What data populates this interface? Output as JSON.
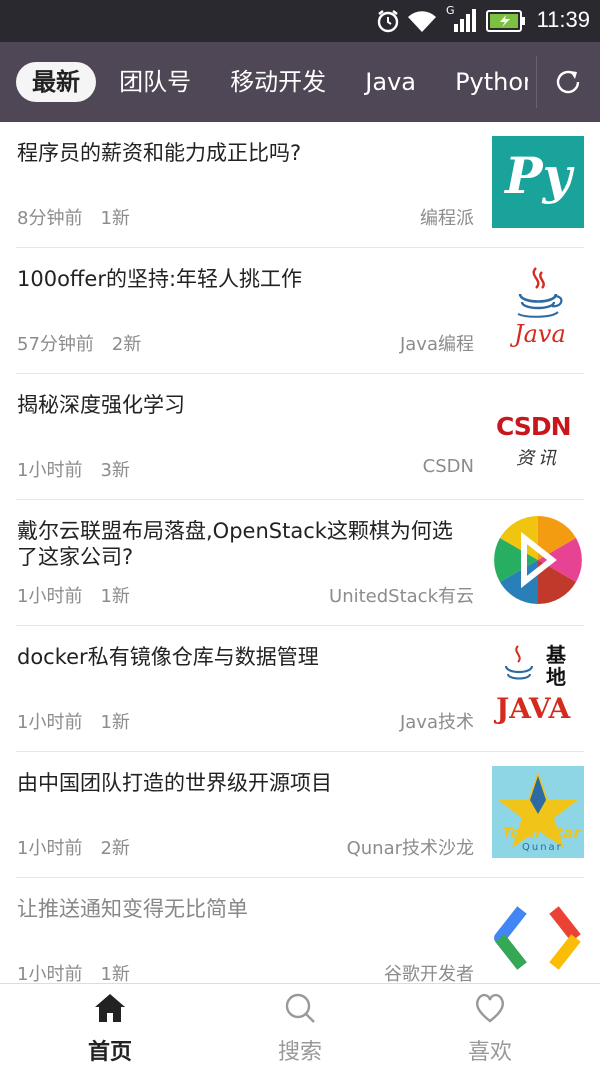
{
  "status": {
    "time": "11:39",
    "network": "G"
  },
  "tabs": [
    {
      "label": "最新",
      "active": true
    },
    {
      "label": "团队号"
    },
    {
      "label": "移动开发"
    },
    {
      "label": "Java"
    },
    {
      "label": "Python"
    }
  ],
  "articles": [
    {
      "title": "程序员的薪资和能力成正比吗?",
      "time": "8分钟前",
      "new_count": "1新",
      "source": "编程派",
      "thumb_icon": "py-logo-icon",
      "thumb_text": "Py"
    },
    {
      "title": "100offer的坚持:年轻人挑工作",
      "time": "57分钟前",
      "new_count": "2新",
      "source": "Java编程",
      "thumb_icon": "java-logo-icon",
      "thumb_text": "Java"
    },
    {
      "title": "揭秘深度强化学习",
      "time": "1小时前",
      "new_count": "3新",
      "source": "CSDN",
      "thumb_icon": "csdn-logo-icon",
      "thumb_text": "CSDN",
      "thumb_sub": "资讯"
    },
    {
      "title": "戴尔云联盟布局落盘,OpenStack这颗棋为何选了这家公司?",
      "time": "1小时前",
      "new_count": "1新",
      "source": "UnitedStack有云",
      "thumb_icon": "unitedstack-logo-icon"
    },
    {
      "title": "docker私有镜像仓库与数据管理",
      "time": "1小时前",
      "new_count": "1新",
      "source": "Java技术",
      "thumb_icon": "java-base-logo-icon",
      "thumb_text": "JAVA",
      "thumb_sub": "基地"
    },
    {
      "title": "由中国团队打造的世界级开源项目",
      "time": "1小时前",
      "new_count": "2新",
      "source": "Qunar技术沙龙",
      "thumb_icon": "techstar-logo-icon",
      "thumb_text": "Tech Star",
      "thumb_sub": "Qunar"
    },
    {
      "title": "让推送通知变得无比简单",
      "time": "1小时前",
      "new_count": "1新",
      "source": "谷歌开发者",
      "thumb_icon": "google-dev-logo-icon"
    }
  ],
  "bottom_nav": [
    {
      "label": "首页",
      "icon": "home-icon",
      "active": true
    },
    {
      "label": "搜索",
      "icon": "search-icon"
    },
    {
      "label": "喜欢",
      "icon": "heart-icon"
    }
  ],
  "colors": {
    "tabbar": "#4f4656",
    "statusbar": "#2b2930",
    "py_green": "#1aa39a",
    "java_red": "#d52b1e"
  }
}
